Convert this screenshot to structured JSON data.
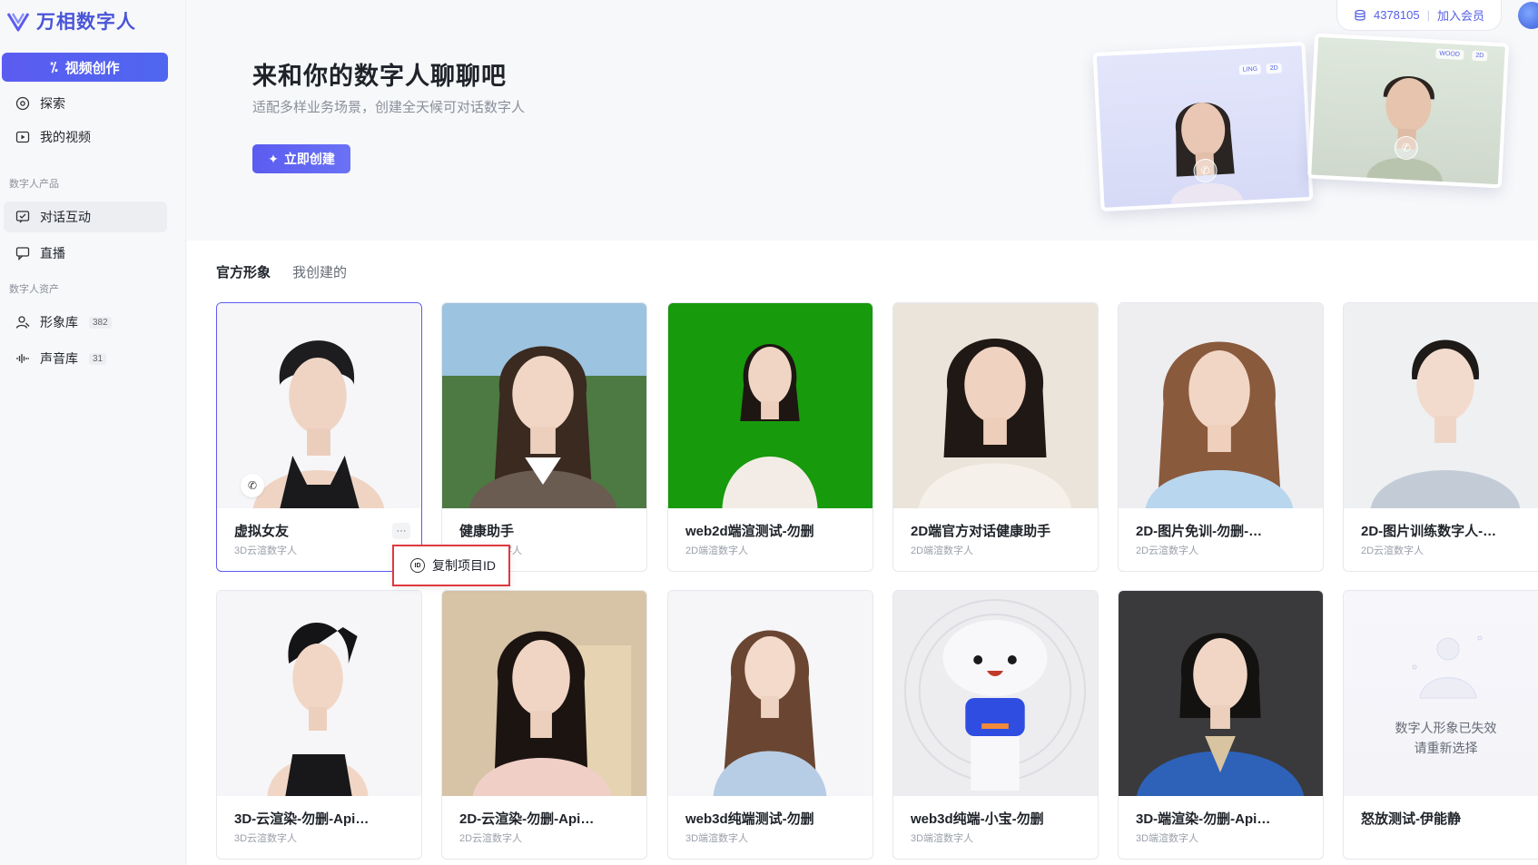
{
  "brand": {
    "name": "万相数字人",
    "accent": "#4a55d8"
  },
  "sidebar": {
    "create_label": "视频创作",
    "items_top": [
      {
        "label": "探索",
        "icon": "compass-icon"
      },
      {
        "label": "我的视频",
        "icon": "video-icon"
      }
    ],
    "section_products": "数字人产品",
    "items_products": [
      {
        "label": "对话互动",
        "icon": "chat-icon",
        "active": true
      },
      {
        "label": "直播",
        "icon": "live-icon"
      }
    ],
    "section_assets": "数字人资产",
    "items_assets": [
      {
        "label": "形象库",
        "icon": "person-icon",
        "count": "382"
      },
      {
        "label": "声音库",
        "icon": "voice-icon",
        "count": "31"
      }
    ]
  },
  "topbar": {
    "credits": "4378105",
    "separator": "|",
    "member_label": "加入会员"
  },
  "hero": {
    "title": "来和你的数字人聊聊吧",
    "subtitle": "适配多样业务场景，创建全天候可对话数字人",
    "button_label": "立即创建",
    "card1_tags": [
      "LING",
      "2D"
    ],
    "card2_tags": [
      "WOOD",
      "2D"
    ]
  },
  "tabs": [
    {
      "label": "官方形象",
      "active": true
    },
    {
      "label": "我创建的",
      "active": false
    }
  ],
  "cards": [
    {
      "name": "虚拟女友",
      "type": "3D云渲数字人",
      "selected": true,
      "bg": "#f5f5f7"
    },
    {
      "name": "健康助手",
      "type": "2D云渲数字人",
      "bg": "#8fb8d8"
    },
    {
      "name": "web2d端渲测试-勿删",
      "type": "2D端渲数字人",
      "bg": "#1a8a0e"
    },
    {
      "name": "2D端官方对话健康助手",
      "type": "2D端渲数字人",
      "bg": "#e8e2da"
    },
    {
      "name": "2D-图片免训-勿删-…",
      "type": "2D云渲数字人",
      "bg": "#eeeef0"
    },
    {
      "name": "2D-图片训练数字人-…",
      "type": "2D云渲数字人",
      "bg": "#eef0f2"
    },
    {
      "name": "3D-云渲染-勿删-Api…",
      "type": "3D云渲数字人",
      "bg": "#f5f5f7"
    },
    {
      "name": "2D-云渲染-勿删-Api…",
      "type": "2D云渲数字人",
      "bg": "#d8c8b0"
    },
    {
      "name": "web3d纯端测试-勿删",
      "type": "3D端渲数字人",
      "bg": "#f5f5f7"
    },
    {
      "name": "web3d纯端-小宝-勿删",
      "type": "3D端渲数字人",
      "bg": "#ededf0"
    },
    {
      "name": "3D-端渲染-勿删-Api…",
      "type": "3D端渲数字人",
      "bg": "#3a3a3c"
    },
    {
      "name": "怒放测试-伊能静",
      "type": "",
      "invalid": true,
      "invalid_lines": [
        "数字人形象已失效",
        "请重新选择"
      ]
    }
  ],
  "popover": {
    "label": "复制项目ID",
    "icon_text": "ID"
  },
  "more_label": "···"
}
